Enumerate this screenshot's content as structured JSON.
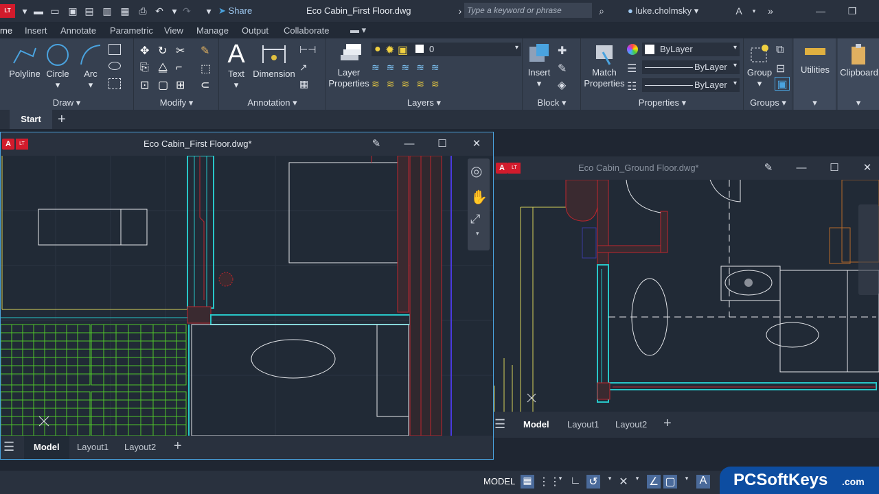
{
  "app": {
    "logo": "LT",
    "document_title": "Eco Cabin_First Floor.dwg",
    "share_label": "Share",
    "search_placeholder": "Type a keyword or phrase",
    "user": "luke.cholmsky"
  },
  "ribbon_tabs": [
    "me",
    "Insert",
    "Annotate",
    "Parametric",
    "View",
    "Manage",
    "Output",
    "Collaborate"
  ],
  "ribbon": {
    "draw": {
      "title": "Draw",
      "tools": [
        "Polyline",
        "Circle",
        "Arc"
      ]
    },
    "modify": {
      "title": "Modify"
    },
    "annotation": {
      "title": "Annotation",
      "tools": [
        "Text",
        "Dimension"
      ]
    },
    "layers": {
      "title": "Layers",
      "tool_line1": "Layer",
      "tool_line2": "Properties",
      "current_layer": "0"
    },
    "block": {
      "title": "Block",
      "tool": "Insert"
    },
    "properties": {
      "title": "Properties",
      "tool_line1": "Match",
      "tool_line2": "Properties",
      "color": "ByLayer",
      "linetype": "ByLayer",
      "lineweight": "ByLayer"
    },
    "groups": {
      "title": "Groups",
      "tool": "Group"
    },
    "utilities": {
      "tool": "Utilities"
    },
    "clipboard": {
      "tool": "Clipboard"
    }
  },
  "file_tabs": {
    "start": "Start"
  },
  "windows": {
    "first_floor": {
      "title": "Eco Cabin_First Floor.dwg*",
      "badge": "A",
      "lt": "LT",
      "tabs": [
        "Model",
        "Layout1",
        "Layout2"
      ]
    },
    "ground_floor": {
      "title": "Eco Cabin_Ground Floor.dwg*",
      "badge": "A",
      "lt": "LT",
      "tabs": [
        "Model",
        "Layout1",
        "Layout2"
      ]
    }
  },
  "statusbar": {
    "mode": "MODEL"
  },
  "watermark": {
    "brand": "PCSoftKeys",
    "suffix": ".com"
  },
  "colors": {
    "accent_blue": "#4aa3df",
    "wall_red": "#c0262e",
    "furniture_green": "#4fc72a",
    "cyan_line": "#28c6c8",
    "yellow_line": "#d8d25a"
  }
}
